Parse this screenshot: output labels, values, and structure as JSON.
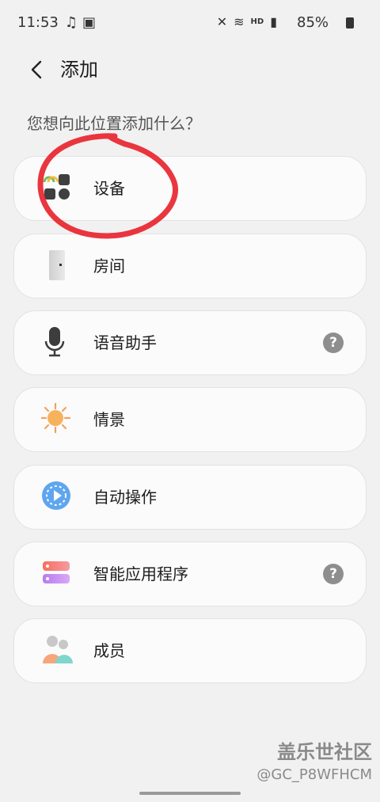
{
  "status_bar": {
    "time": "11:53",
    "battery_percent": "85%",
    "icons": [
      "listen-icon",
      "image-icon",
      "mute-icon",
      "wifi-icon",
      "hd-icon",
      "4g-signal-icon",
      "battery-icon"
    ]
  },
  "header": {
    "title": "添加"
  },
  "prompt": "您想向此位置添加什么？",
  "items": [
    {
      "label": "设备",
      "icon": "device-icon",
      "help": false
    },
    {
      "label": "房间",
      "icon": "door-icon",
      "help": false
    },
    {
      "label": "语音助手",
      "icon": "microphone-icon",
      "help": true
    },
    {
      "label": "情景",
      "icon": "sun-icon",
      "help": false
    },
    {
      "label": "自动操作",
      "icon": "automation-play-icon",
      "help": false
    },
    {
      "label": "智能应用程序",
      "icon": "smartapp-icon",
      "help": true
    },
    {
      "label": "成员",
      "icon": "members-icon",
      "help": false
    }
  ],
  "help_glyph": "?",
  "watermark": {
    "main": "盖乐世社区",
    "sub": "@GC_P8WFHCM"
  },
  "colors": {
    "annotation": "#e8202a",
    "background": "#f1f1f1",
    "card": "#fbfbfb"
  }
}
